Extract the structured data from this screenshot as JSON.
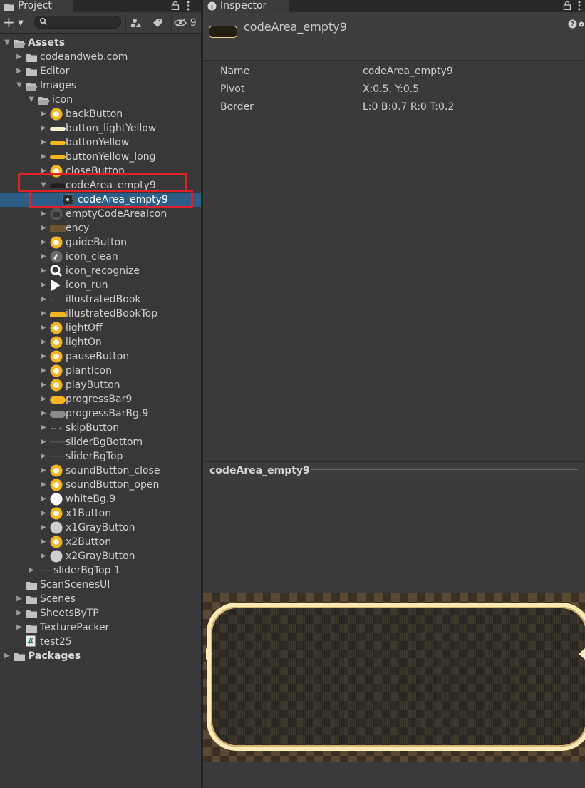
{
  "project_panel": {
    "tab_title": "Project",
    "tab_icon": "folder-icon",
    "hidden_count": "9",
    "search_placeholder": "",
    "tree": [
      {
        "label": "Assets",
        "depth": 0,
        "icon": "folder-open-icon",
        "arrow": "down",
        "bold": true
      },
      {
        "label": "codeandweb.com",
        "depth": 1,
        "icon": "folder-icon",
        "arrow": "right"
      },
      {
        "label": "Editor",
        "depth": 1,
        "icon": "folder-icon",
        "arrow": "right"
      },
      {
        "label": "Images",
        "depth": 1,
        "icon": "folder-open-icon",
        "arrow": "down"
      },
      {
        "label": "icon",
        "depth": 2,
        "icon": "folder-open-icon",
        "arrow": "down"
      },
      {
        "label": "backButton",
        "depth": 3,
        "icon": "back-arrow-sprite-icon",
        "arrow": "right",
        "color": "#f5b51f"
      },
      {
        "label": "button_lightYellow",
        "depth": 3,
        "icon": "light-yellow-bar-sprite-icon",
        "arrow": "right",
        "color": "#f7f1d0"
      },
      {
        "label": "buttonYellow",
        "depth": 3,
        "icon": "yellow-bar-sprite-icon",
        "arrow": "right",
        "color": "#f5b51f"
      },
      {
        "label": "buttonYellow_long",
        "depth": 3,
        "icon": "yellow-long-bar-sprite-icon",
        "arrow": "right",
        "color": "#f5b51f"
      },
      {
        "label": "closeButton",
        "depth": 3,
        "icon": "close-circle-sprite-icon",
        "arrow": "right",
        "color": "#f5b51f"
      },
      {
        "label": "codeArea_empty9",
        "depth": 3,
        "icon": "dark-panel-sprite-icon",
        "arrow": "down",
        "color": "#222222"
      },
      {
        "label": "codeArea_empty9",
        "depth": 4,
        "icon": "sprite-slice-icon",
        "arrow": "none",
        "selected": true
      },
      {
        "label": "emptyCodeAreaIcon",
        "depth": 3,
        "icon": "empty-code-area-sprite-icon",
        "arrow": "right",
        "color": "#5a5a5a"
      },
      {
        "label": "ency",
        "depth": 3,
        "icon": "brown-panel-sprite-icon",
        "arrow": "right",
        "color": "#6b5630"
      },
      {
        "label": "guideButton",
        "depth": 3,
        "icon": "guide-circle-sprite-icon",
        "arrow": "right",
        "color": "#f5b51f"
      },
      {
        "label": "icon_clean",
        "depth": 3,
        "icon": "broom-sprite-icon",
        "arrow": "right",
        "color": "#e0e0e0"
      },
      {
        "label": "icon_recognize",
        "depth": 3,
        "icon": "magnifier-sprite-icon",
        "arrow": "right",
        "color": "#ffffff"
      },
      {
        "label": "icon_run",
        "depth": 3,
        "icon": "play-triangle-sprite-icon",
        "arrow": "right",
        "color": "#ffffff"
      },
      {
        "label": "illustratedBook",
        "depth": 3,
        "icon": "tiny-dot-sprite-icon",
        "arrow": "right",
        "color": "#888888"
      },
      {
        "label": "illustratedBookTop",
        "depth": 3,
        "icon": "yellow-tab-sprite-icon",
        "arrow": "right",
        "color": "#f5b51f"
      },
      {
        "label": "lightOff",
        "depth": 3,
        "icon": "bulb-off-sprite-icon",
        "arrow": "right",
        "color": "#f5b51f"
      },
      {
        "label": "lightOn",
        "depth": 3,
        "icon": "bulb-on-sprite-icon",
        "arrow": "right",
        "color": "#f5b51f"
      },
      {
        "label": "pauseButton",
        "depth": 3,
        "icon": "pause-circle-sprite-icon",
        "arrow": "right",
        "color": "#f5b51f"
      },
      {
        "label": "plantIcon",
        "depth": 3,
        "icon": "leaf-circle-sprite-icon",
        "arrow": "right",
        "color": "#f5b51f"
      },
      {
        "label": "playButton",
        "depth": 3,
        "icon": "play-circle-sprite-icon",
        "arrow": "right",
        "color": "#f5b51f"
      },
      {
        "label": "progressBar9",
        "depth": 3,
        "icon": "yellow-progress-sprite-icon",
        "arrow": "right",
        "color": "#f5b51f"
      },
      {
        "label": "progressBarBg.9",
        "depth": 3,
        "icon": "gray-progress-sprite-icon",
        "arrow": "right",
        "color": "#8a8a8a"
      },
      {
        "label": "skipButton",
        "depth": 3,
        "icon": "skip-dots-sprite-icon",
        "arrow": "right",
        "color": "#8a8a8a"
      },
      {
        "label": "sliderBgBottom",
        "depth": 3,
        "icon": "thin-line-sprite-icon",
        "arrow": "right",
        "color": "#555555"
      },
      {
        "label": "sliderBgTop",
        "depth": 3,
        "icon": "thin-line-sprite-icon",
        "arrow": "right",
        "color": "#555555"
      },
      {
        "label": "soundButton_close",
        "depth": 3,
        "icon": "sound-off-circle-sprite-icon",
        "arrow": "right",
        "color": "#f5b51f"
      },
      {
        "label": "soundButton_open",
        "depth": 3,
        "icon": "sound-on-circle-sprite-icon",
        "arrow": "right",
        "color": "#f5b51f"
      },
      {
        "label": "whiteBg.9",
        "depth": 3,
        "icon": "white-circle-sprite-icon",
        "arrow": "right",
        "color": "#ffffff"
      },
      {
        "label": "x1Button",
        "depth": 3,
        "icon": "x1-circle-sprite-icon",
        "arrow": "right",
        "color": "#f5b51f"
      },
      {
        "label": "x1GrayButton",
        "depth": 3,
        "icon": "x1-gray-circle-sprite-icon",
        "arrow": "right",
        "color": "#cfcfcf"
      },
      {
        "label": "x2Button",
        "depth": 3,
        "icon": "x2-circle-sprite-icon",
        "arrow": "right",
        "color": "#f5b51f"
      },
      {
        "label": "x2GrayButton",
        "depth": 3,
        "icon": "x2-gray-circle-sprite-icon",
        "arrow": "right",
        "color": "#cfcfcf"
      },
      {
        "label": "sliderBgTop 1",
        "depth": 2,
        "icon": "thin-line-sprite-icon",
        "arrow": "right",
        "color": "#555555"
      },
      {
        "label": "ScanScenesUI",
        "depth": 1,
        "icon": "folder-icon",
        "arrow": "none"
      },
      {
        "label": "Scenes",
        "depth": 1,
        "icon": "folder-icon",
        "arrow": "right"
      },
      {
        "label": "SheetsByTP",
        "depth": 1,
        "icon": "folder-icon",
        "arrow": "right"
      },
      {
        "label": "TexturePacker",
        "depth": 1,
        "icon": "folder-icon",
        "arrow": "right"
      },
      {
        "label": "test25",
        "depth": 1,
        "icon": "csharp-script-icon",
        "arrow": "none"
      },
      {
        "label": "Packages",
        "depth": 0,
        "icon": "folder-icon",
        "arrow": "right",
        "bold": true
      }
    ]
  },
  "inspector": {
    "tab_title": "Inspector",
    "tab_icon": "info-icon",
    "asset_title": "codeArea_empty9",
    "properties": [
      {
        "name": "Name",
        "value": "codeArea_empty9"
      },
      {
        "name": "Pivot",
        "value": "X:0.5, Y:0.5"
      },
      {
        "name": "Border",
        "value": "L:0 B:0.7 R:0 T:0.2"
      }
    ],
    "preview_title": "codeArea_empty9"
  },
  "colors": {
    "accent_select": "#2c5d87",
    "highlight_red": "#e3202a",
    "sprite_border": "#fbeab6"
  }
}
